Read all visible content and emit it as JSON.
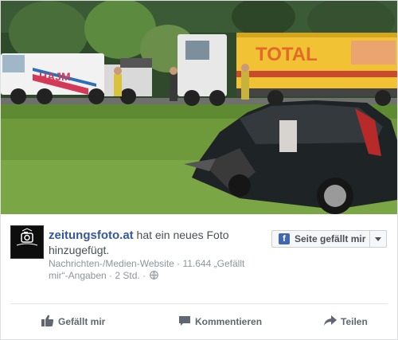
{
  "post": {
    "page_name": "zeitungsfoto.at",
    "action_text": "hat ein neues Foto hinzugefügt.",
    "meta": "Nachrichten-/Medien-Website · 11.644 „Gefällt mir“-Angaben · 2 Std. ·",
    "audience_icon": "globe-icon",
    "avatar_icon": "camera-logo-icon",
    "avatar_caption": "ZEITUNGSFOTO"
  },
  "like_page_button": {
    "label": "Seite gefällt mir",
    "icon": "facebook-f-icon",
    "dropdown_icon": "caret-down-icon"
  },
  "actions": {
    "like": "Gefällt mir",
    "comment": "Kommentieren",
    "share": "Teilen"
  },
  "photo": {
    "truck_text": "HAJM",
    "trailer_text": "TOTAL"
  },
  "colors": {
    "link_blue": "#365899",
    "facebook_blue": "#4267b2",
    "text_grey": "#90949c",
    "action_grey": "#606770"
  }
}
